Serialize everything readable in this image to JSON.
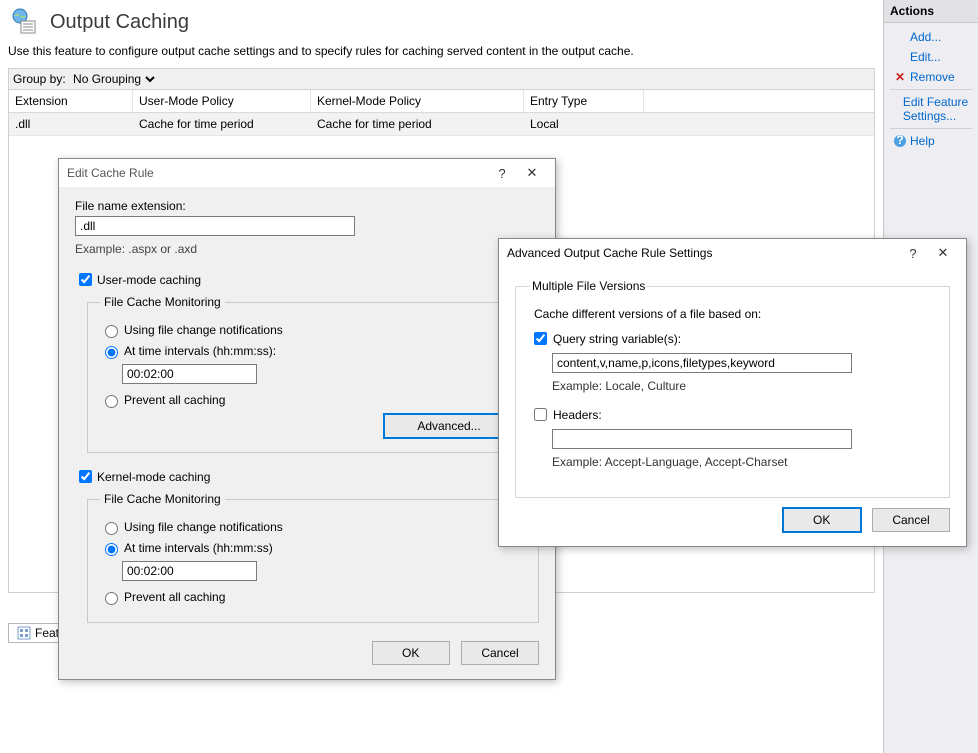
{
  "page": {
    "title": "Output Caching",
    "description": "Use this feature to configure output cache settings and to specify rules for caching served content in the output cache."
  },
  "groupby": {
    "label": "Group by:",
    "selected": "No Grouping"
  },
  "grid": {
    "headers": {
      "ext": "Extension",
      "um": "User-Mode Policy",
      "km": "Kernel-Mode Policy",
      "et": "Entry Type"
    },
    "rows": [
      {
        "ext": ".dll",
        "um": "Cache for time period",
        "km": "Cache for time period",
        "et": "Local"
      }
    ]
  },
  "footer_tab": {
    "label": "Features View"
  },
  "actions": {
    "title": "Actions",
    "add": "Add...",
    "edit": "Edit...",
    "remove": "Remove",
    "edit_feature": "Edit Feature Settings...",
    "help": "Help"
  },
  "edit_dialog": {
    "title": "Edit Cache Rule",
    "file_ext_label": "File name extension:",
    "file_ext_value": ".dll",
    "file_ext_hint": "Example: .aspx or .axd",
    "user_mode_label": "User-mode caching",
    "cache_monitoring_legend": "File Cache Monitoring",
    "radio_notify": "Using file change notifications",
    "radio_interval": "At time intervals (hh:mm:ss):",
    "radio_interval_nocolon": "At time intervals (hh:mm:ss)",
    "interval_value": "00:02:00",
    "radio_prevent": "Prevent all caching",
    "advanced_btn": "Advanced...",
    "kernel_mode_label": "Kernel-mode caching",
    "ok": "OK",
    "cancel": "Cancel"
  },
  "adv_dialog": {
    "title": "Advanced Output Cache Rule Settings",
    "legend": "Multiple File Versions",
    "sublabel": "Cache different versions of a file based on:",
    "query_label": "Query string variable(s):",
    "query_value": "content,v,name,p,icons,filetypes,keyword",
    "query_hint": "Example: Locale, Culture",
    "headers_label": "Headers:",
    "headers_value": "",
    "headers_hint": "Example: Accept-Language, Accept-Charset",
    "ok": "OK",
    "cancel": "Cancel"
  }
}
